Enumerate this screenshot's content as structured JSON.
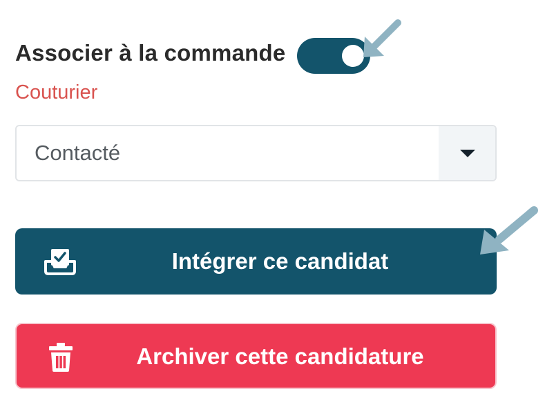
{
  "association": {
    "label": "Associer à la commande",
    "toggle_on": true
  },
  "role": {
    "label": "Couturier"
  },
  "status_select": {
    "selected": "Contacté"
  },
  "actions": {
    "integrate_label": "Intégrer ce candidat",
    "archive_label": "Archiver cette candidature"
  },
  "colors": {
    "primary": "#13546b",
    "danger": "#ee3953",
    "role_text": "#d9534f",
    "pointer": "#8fb3c2"
  },
  "icons": {
    "integrate": "inbox-check-icon",
    "archive": "trash-icon",
    "select": "caret-down-icon",
    "pointer": "pointer-arrow-icon"
  }
}
